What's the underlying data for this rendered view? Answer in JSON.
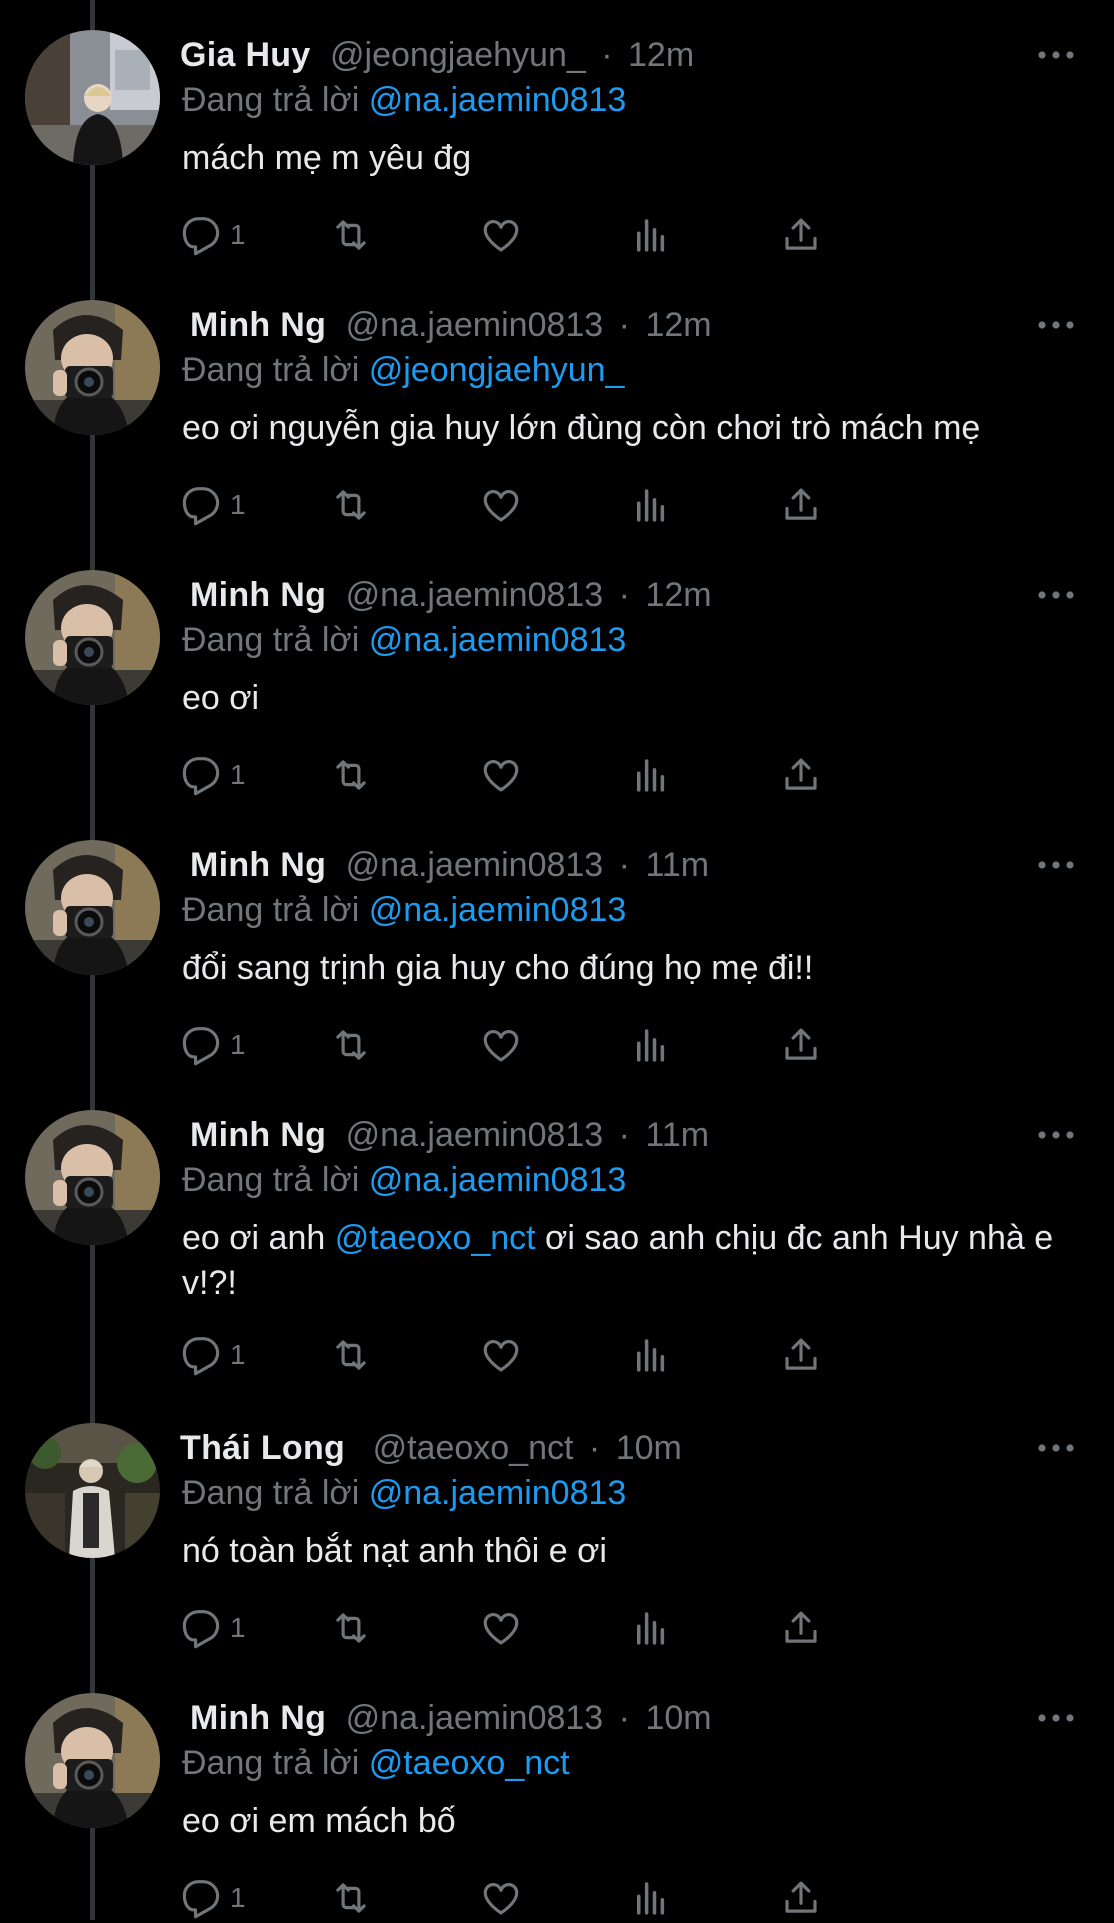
{
  "tweets": [
    {
      "name": "Gia Huy",
      "handle": "@jeongjaehyun_",
      "sep": "·",
      "time": "12m",
      "reply_prefix": "Đang trả lời",
      "reply_to": "@na.jaemin0813",
      "text": "mách mẹ m yêu đg",
      "reply_count": "1",
      "avatar": "gia-huy"
    },
    {
      "name": "Minh Ng",
      "handle": "@na.jaemin0813",
      "sep": "·",
      "time": "12m",
      "reply_prefix": "Đang trả lời",
      "reply_to": "@jeongjaehyun_",
      "text": "eo ơi nguyễn gia huy lớn đùng còn chơi trò mách mẹ",
      "reply_count": "1",
      "avatar": "minh-ng"
    },
    {
      "name": "Minh Ng",
      "handle": "@na.jaemin0813",
      "sep": "·",
      "time": "12m",
      "reply_prefix": "Đang trả lời",
      "reply_to": "@na.jaemin0813",
      "text": "eo ơi",
      "reply_count": "1",
      "avatar": "minh-ng"
    },
    {
      "name": "Minh Ng",
      "handle": "@na.jaemin0813",
      "sep": "·",
      "time": "11m",
      "reply_prefix": "Đang trả lời",
      "reply_to": "@na.jaemin0813",
      "text": "đổi sang trịnh gia huy cho đúng họ mẹ đi!!",
      "reply_count": "1",
      "avatar": "minh-ng"
    },
    {
      "name": "Minh Ng",
      "handle": "@na.jaemin0813",
      "sep": "·",
      "time": "11m",
      "reply_prefix": "Đang trả lời",
      "reply_to": "@na.jaemin0813",
      "text_before": "eo ơi anh ",
      "text_mention": "@taeoxo_nct",
      "text_after": " ơi sao anh chịu đc anh Huy nhà e v!?!",
      "reply_count": "1",
      "avatar": "minh-ng"
    },
    {
      "name": "Thái Long",
      "handle": "@taeoxo_nct",
      "sep": "·",
      "time": "10m",
      "reply_prefix": "Đang trả lời",
      "reply_to": "@na.jaemin0813",
      "text": "nó toàn bắt nạt anh thôi e ơi",
      "reply_count": "1",
      "avatar": "thai-long"
    },
    {
      "name": "Minh Ng",
      "handle": "@na.jaemin0813",
      "sep": "·",
      "time": "10m",
      "reply_prefix": "Đang trả lời",
      "reply_to": "@taeoxo_nct",
      "text": "eo ơi em mách bố",
      "reply_count": "1",
      "avatar": "minh-ng"
    }
  ],
  "icons": {
    "reply": "reply-icon",
    "retweet": "retweet-icon",
    "like": "heart-icon",
    "views": "views-icon",
    "share": "share-icon",
    "more": "more-icon"
  },
  "colors": {
    "background": "#000000",
    "text": "#e7e9ea",
    "secondary": "#71767b",
    "link": "#1d9bf0",
    "thread_line": "#333639"
  }
}
